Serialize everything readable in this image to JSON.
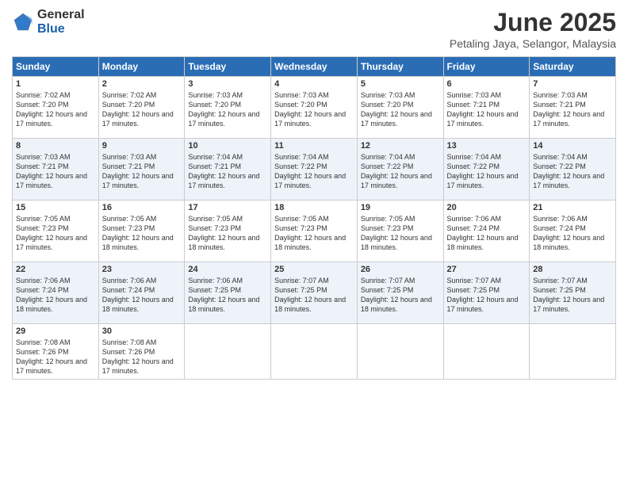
{
  "header": {
    "logo_general": "General",
    "logo_blue": "Blue",
    "month_title": "June 2025",
    "location": "Petaling Jaya, Selangor, Malaysia"
  },
  "days_of_week": [
    "Sunday",
    "Monday",
    "Tuesday",
    "Wednesday",
    "Thursday",
    "Friday",
    "Saturday"
  ],
  "weeks": [
    [
      {
        "day": 1,
        "sunrise": "7:02 AM",
        "sunset": "7:20 PM",
        "daylight": "12 hours and 17 minutes."
      },
      {
        "day": 2,
        "sunrise": "7:02 AM",
        "sunset": "7:20 PM",
        "daylight": "12 hours and 17 minutes."
      },
      {
        "day": 3,
        "sunrise": "7:03 AM",
        "sunset": "7:20 PM",
        "daylight": "12 hours and 17 minutes."
      },
      {
        "day": 4,
        "sunrise": "7:03 AM",
        "sunset": "7:20 PM",
        "daylight": "12 hours and 17 minutes."
      },
      {
        "day": 5,
        "sunrise": "7:03 AM",
        "sunset": "7:20 PM",
        "daylight": "12 hours and 17 minutes."
      },
      {
        "day": 6,
        "sunrise": "7:03 AM",
        "sunset": "7:21 PM",
        "daylight": "12 hours and 17 minutes."
      },
      {
        "day": 7,
        "sunrise": "7:03 AM",
        "sunset": "7:21 PM",
        "daylight": "12 hours and 17 minutes."
      }
    ],
    [
      {
        "day": 8,
        "sunrise": "7:03 AM",
        "sunset": "7:21 PM",
        "daylight": "12 hours and 17 minutes."
      },
      {
        "day": 9,
        "sunrise": "7:03 AM",
        "sunset": "7:21 PM",
        "daylight": "12 hours and 17 minutes."
      },
      {
        "day": 10,
        "sunrise": "7:04 AM",
        "sunset": "7:21 PM",
        "daylight": "12 hours and 17 minutes."
      },
      {
        "day": 11,
        "sunrise": "7:04 AM",
        "sunset": "7:22 PM",
        "daylight": "12 hours and 17 minutes."
      },
      {
        "day": 12,
        "sunrise": "7:04 AM",
        "sunset": "7:22 PM",
        "daylight": "12 hours and 17 minutes."
      },
      {
        "day": 13,
        "sunrise": "7:04 AM",
        "sunset": "7:22 PM",
        "daylight": "12 hours and 17 minutes."
      },
      {
        "day": 14,
        "sunrise": "7:04 AM",
        "sunset": "7:22 PM",
        "daylight": "12 hours and 17 minutes."
      }
    ],
    [
      {
        "day": 15,
        "sunrise": "7:05 AM",
        "sunset": "7:23 PM",
        "daylight": "12 hours and 17 minutes."
      },
      {
        "day": 16,
        "sunrise": "7:05 AM",
        "sunset": "7:23 PM",
        "daylight": "12 hours and 18 minutes."
      },
      {
        "day": 17,
        "sunrise": "7:05 AM",
        "sunset": "7:23 PM",
        "daylight": "12 hours and 18 minutes."
      },
      {
        "day": 18,
        "sunrise": "7:05 AM",
        "sunset": "7:23 PM",
        "daylight": "12 hours and 18 minutes."
      },
      {
        "day": 19,
        "sunrise": "7:05 AM",
        "sunset": "7:23 PM",
        "daylight": "12 hours and 18 minutes."
      },
      {
        "day": 20,
        "sunrise": "7:06 AM",
        "sunset": "7:24 PM",
        "daylight": "12 hours and 18 minutes."
      },
      {
        "day": 21,
        "sunrise": "7:06 AM",
        "sunset": "7:24 PM",
        "daylight": "12 hours and 18 minutes."
      }
    ],
    [
      {
        "day": 22,
        "sunrise": "7:06 AM",
        "sunset": "7:24 PM",
        "daylight": "12 hours and 18 minutes."
      },
      {
        "day": 23,
        "sunrise": "7:06 AM",
        "sunset": "7:24 PM",
        "daylight": "12 hours and 18 minutes."
      },
      {
        "day": 24,
        "sunrise": "7:06 AM",
        "sunset": "7:25 PM",
        "daylight": "12 hours and 18 minutes."
      },
      {
        "day": 25,
        "sunrise": "7:07 AM",
        "sunset": "7:25 PM",
        "daylight": "12 hours and 18 minutes."
      },
      {
        "day": 26,
        "sunrise": "7:07 AM",
        "sunset": "7:25 PM",
        "daylight": "12 hours and 18 minutes."
      },
      {
        "day": 27,
        "sunrise": "7:07 AM",
        "sunset": "7:25 PM",
        "daylight": "12 hours and 17 minutes."
      },
      {
        "day": 28,
        "sunrise": "7:07 AM",
        "sunset": "7:25 PM",
        "daylight": "12 hours and 17 minutes."
      }
    ],
    [
      {
        "day": 29,
        "sunrise": "7:08 AM",
        "sunset": "7:26 PM",
        "daylight": "12 hours and 17 minutes."
      },
      {
        "day": 30,
        "sunrise": "7:08 AM",
        "sunset": "7:26 PM",
        "daylight": "12 hours and 17 minutes."
      },
      null,
      null,
      null,
      null,
      null
    ]
  ]
}
